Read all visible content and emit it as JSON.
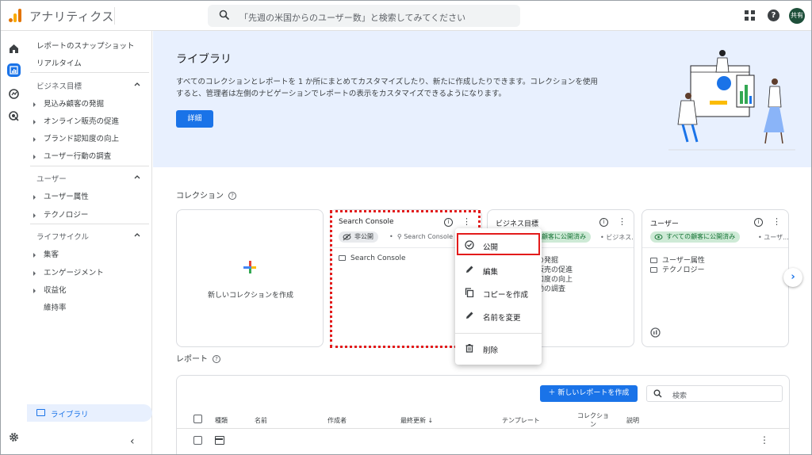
{
  "app": {
    "title": "アナリティクス"
  },
  "search": {
    "placeholder": "「先週の米国からのユーザー数」と検索してみてください"
  },
  "header": {
    "avatar_label": "共有"
  },
  "sidebar": {
    "top_items": [
      "レポートのスナップショット",
      "リアルタイム"
    ],
    "sections": [
      {
        "title": "ビジネス目標",
        "items": [
          "見込み顧客の発掘",
          "オンライン販売の促進",
          "ブランド認知度の向上",
          "ユーザー行動の調査"
        ]
      },
      {
        "title": "ユーザー",
        "items": [
          "ユーザー属性",
          "テクノロジー"
        ]
      },
      {
        "title": "ライフサイクル",
        "items": [
          "集客",
          "エンゲージメント",
          "収益化"
        ],
        "extra": "維持率"
      }
    ],
    "library_label": "ライブラリ"
  },
  "hero": {
    "title": "ライブラリ",
    "description": "すべてのコレクションとレポートを 1 か所にまとめてカスタマイズしたり、新たに作成したりできます。コレクションを使用すると、管理者は左側のナビゲーションでレポートの表示をカスタマイズできるようになります。",
    "button": "詳細"
  },
  "collections": {
    "title": "コレクション",
    "new_label": "新しいコレクションを作成",
    "cards": [
      {
        "title": "Search Console",
        "chip": "非公開",
        "meta": "Search Console",
        "lines": [
          "Search Console"
        ]
      },
      {
        "title": "ビジネス目標",
        "chip": "顧客に公開済み",
        "meta": "ビジネス...",
        "lines": [
          "の発掘",
          "販売の促進",
          "知度の向上",
          "動の調査"
        ]
      },
      {
        "title": "ユーザー",
        "chip": "すべての顧客に公開済み",
        "meta": "ユーザ...",
        "lines": [
          "ユーザー属性",
          "テクノロジー"
        ]
      }
    ]
  },
  "menu": {
    "items": [
      "公開",
      "編集",
      "コピーを作成",
      "名前を変更",
      "削除"
    ]
  },
  "reports": {
    "title": "レポート",
    "new_button": "新しいレポートを作成",
    "search_placeholder": "検索",
    "columns": [
      "種類",
      "名前",
      "作成者",
      "最終更新",
      "テンプレート",
      "コレクション",
      "説明"
    ]
  },
  "colors": {
    "accent": "#1a73e8",
    "highlight": "#e31b1b",
    "hero_bg": "#e8f0fe",
    "published_chip": "#ceead6"
  }
}
